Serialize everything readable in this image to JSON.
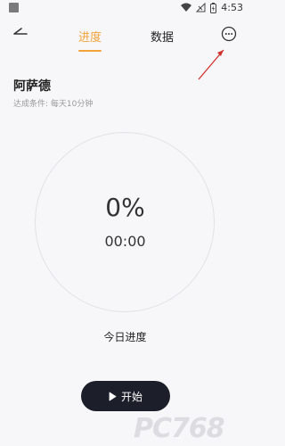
{
  "status_bar": {
    "time": "4:53",
    "icons": [
      "app-icon",
      "wifi-icon",
      "no-signal-icon",
      "battery-charging-icon"
    ]
  },
  "nav": {
    "back_icon": "back-arrow-icon",
    "tabs": [
      {
        "label": "进度",
        "active": true
      },
      {
        "label": "数据",
        "active": false
      }
    ],
    "more_icon": "more-options-icon"
  },
  "task": {
    "title": "阿萨德",
    "condition": "达成条件: 每天10分钟"
  },
  "progress": {
    "percent": "0%",
    "elapsed": "00:00",
    "label": "今日进度"
  },
  "actions": {
    "start_label": "开始",
    "start_icon": "play-icon"
  },
  "watermark": {
    "text": "PC768"
  },
  "colors": {
    "accent": "#f2a33a",
    "button_bg": "#1c1f2a",
    "annotation_arrow": "#d0302b"
  }
}
